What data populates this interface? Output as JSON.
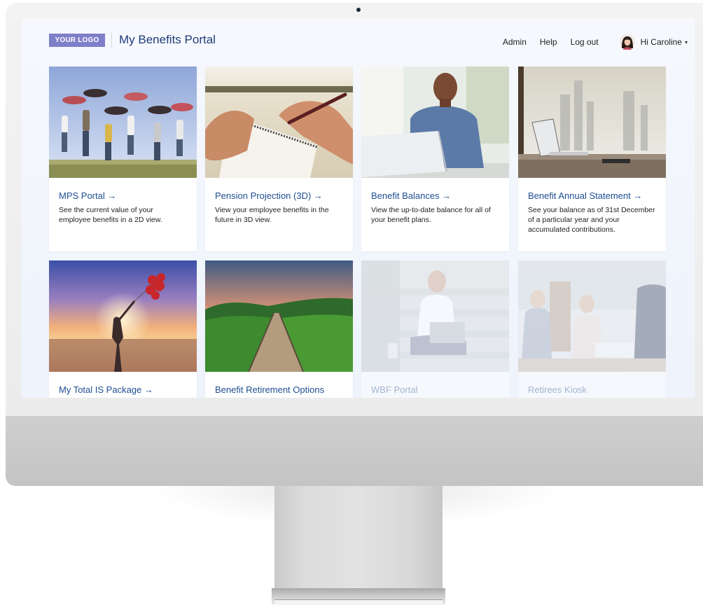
{
  "header": {
    "logo_text": "YOUR LOGO",
    "portal_title": "My Benefits Portal",
    "nav": {
      "admin": "Admin",
      "help": "Help",
      "logout": "Log out"
    },
    "user_greeting": "Hi Caroline",
    "dropdown_caret": "▾"
  },
  "cards": [
    {
      "title": "MPS Portal →",
      "description": "See the current value of your employee benefits in a 2D view."
    },
    {
      "title": "Pension Projection (3D) →",
      "description": "View your employee benefits in the future in 3D view."
    },
    {
      "title": "Benefit Balances →",
      "description": "View the up-to-date balance for all of your benefit plans."
    },
    {
      "title": "Benefit Annual Statement →",
      "description": "See your balance as of 31st December of a particular year and your accumulated contributions."
    },
    {
      "title": "My Total IS Package →"
    },
    {
      "title": "Benefit Retirement Options"
    },
    {
      "title": "WBF Portal"
    },
    {
      "title": "Retirees Kiosk"
    }
  ],
  "colors": {
    "logo_bg": "#7f7fc9",
    "title_blue": "#1f3c7a",
    "card_title_blue": "#1f4e92",
    "screen_bg": "#f1f5fd"
  },
  "icons": {
    "avatar": "user-avatar-icon",
    "caret": "chevron-down-icon"
  }
}
